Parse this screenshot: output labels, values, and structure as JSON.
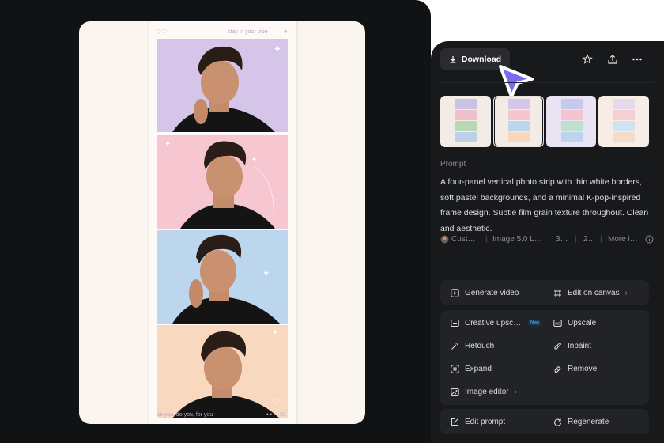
{
  "strip": {
    "top_tag": "stay in your vibe",
    "bottom_caption": "be you, do you, for you",
    "bottom_dots": "• •",
    "bottom_number": "01",
    "colors": [
      "#d4c4e8",
      "#f5c6cf",
      "#bcd5ec",
      "#f8d8bf"
    ]
  },
  "header": {
    "download_label": "Download",
    "icons": [
      "star-icon",
      "share-icon",
      "more-icon"
    ]
  },
  "prompt": {
    "label": "Prompt",
    "text": "A four-panel vertical photo strip with thin white borders, soft pastel backgrounds, and a minimal K-pop-inspired frame design. Subtle film grain texture throughout. Clean and aesthetic."
  },
  "meta": {
    "items": [
      "Cust…",
      "Image 5.0 L…",
      "3…",
      "2…",
      "More i…"
    ]
  },
  "actions": {
    "generate_video": "Generate video",
    "edit_on_canvas": "Edit on canvas",
    "creative_upscale": "Creative upsc…",
    "new_badge": "New",
    "upscale": "Upscale",
    "retouch": "Retouch",
    "inpaint": "Inpaint",
    "expand": "Expand",
    "remove": "Remove",
    "image_editor": "Image editor",
    "edit_prompt": "Edit prompt",
    "regenerate": "Regenerate"
  }
}
